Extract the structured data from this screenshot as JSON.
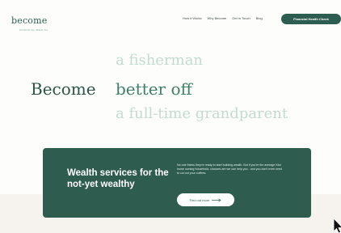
{
  "colors": {
    "brand_green": "#2d5c50",
    "accent_green": "#3d8069",
    "faded_green": "#c2dccf",
    "background": "#fdfdfc"
  },
  "header": {
    "logo": "become",
    "logo_tagline": "FINANCIAL WEALTH",
    "nav": [
      "How it Works",
      "Why Become",
      "Get in Touch",
      "Blog"
    ],
    "cta": "Financial Health Check"
  },
  "hero": {
    "prefix": "Become",
    "words": [
      "a fisherman",
      "better off",
      "a full-time grandparent"
    ]
  },
  "card": {
    "title": "Wealth services for the not-yet wealthy",
    "text": "No one thinks they're ready to start building wealth. But if you're the average Kiwi home owning household, chances are we can help you - and you don't even need to cut out your coffees.",
    "button": "Find out more",
    "button_icon": "arrow-right-icon"
  },
  "cursor_icon": "mouse-cursor-icon"
}
